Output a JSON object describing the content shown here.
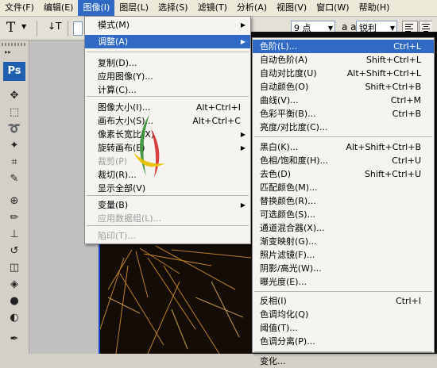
{
  "menubar": {
    "items": [
      "文件(F)",
      "编辑(E)",
      "图像(I)",
      "图层(L)",
      "选择(S)",
      "滤镜(T)",
      "分析(A)",
      "视图(V)",
      "窗口(W)",
      "帮助(H)"
    ],
    "active_index": 2
  },
  "options_bar": {
    "tool_glyph": "T",
    "font_size": "9 点",
    "antialias_icon": "a a",
    "antialias": "锐利"
  },
  "toolbox": {
    "logo": "Ps"
  },
  "image_menu": {
    "items": [
      {
        "label": "模式(M)",
        "shortcut": "",
        "submenu": true,
        "disabled": false,
        "highlighted": false
      },
      {
        "label": "调整(A)",
        "shortcut": "",
        "submenu": true,
        "disabled": false,
        "highlighted": true
      },
      {
        "label": "复制(D)...",
        "shortcut": "",
        "submenu": false,
        "disabled": false,
        "highlighted": false
      },
      {
        "label": "应用图像(Y)...",
        "shortcut": "",
        "submenu": false,
        "disabled": false,
        "highlighted": false
      },
      {
        "label": "计算(C)...",
        "shortcut": "",
        "submenu": false,
        "disabled": false,
        "highlighted": false
      },
      {
        "label": "图像大小(I)...",
        "shortcut": "Alt+Ctrl+I",
        "submenu": false,
        "disabled": false,
        "highlighted": false
      },
      {
        "label": "画布大小(S)...",
        "shortcut": "Alt+Ctrl+C",
        "submenu": false,
        "disabled": false,
        "highlighted": false
      },
      {
        "label": "像素长宽比(X)",
        "shortcut": "",
        "submenu": true,
        "disabled": false,
        "highlighted": false
      },
      {
        "label": "旋转画布(E)",
        "shortcut": "",
        "submenu": true,
        "disabled": false,
        "highlighted": false
      },
      {
        "label": "裁剪(P)",
        "shortcut": "",
        "submenu": false,
        "disabled": true,
        "highlighted": false
      },
      {
        "label": "裁切(R)...",
        "shortcut": "",
        "submenu": false,
        "disabled": false,
        "highlighted": false
      },
      {
        "label": "显示全部(V)",
        "shortcut": "",
        "submenu": false,
        "disabled": false,
        "highlighted": false
      },
      {
        "label": "变量(B)",
        "shortcut": "",
        "submenu": true,
        "disabled": false,
        "highlighted": false
      },
      {
        "label": "应用数据组(L)...",
        "shortcut": "",
        "submenu": false,
        "disabled": true,
        "highlighted": false
      },
      {
        "label": "陷印(T)...",
        "shortcut": "",
        "submenu": false,
        "disabled": true,
        "highlighted": false
      }
    ]
  },
  "adjust_menu": {
    "items": [
      {
        "label": "色阶(L)...",
        "shortcut": "Ctrl+L",
        "highlighted": true
      },
      {
        "label": "自动色阶(A)",
        "shortcut": "Shift+Ctrl+L",
        "highlighted": false
      },
      {
        "label": "自动对比度(U)",
        "shortcut": "Alt+Shift+Ctrl+L",
        "highlighted": false
      },
      {
        "label": "自动颜色(O)",
        "shortcut": "Shift+Ctrl+B",
        "highlighted": false
      },
      {
        "label": "曲线(V)...",
        "shortcut": "Ctrl+M",
        "highlighted": false
      },
      {
        "label": "色彩平衡(B)...",
        "shortcut": "Ctrl+B",
        "highlighted": false
      },
      {
        "label": "亮度/对比度(C)...",
        "shortcut": "",
        "highlighted": false
      },
      {
        "label": "黑白(K)...",
        "shortcut": "Alt+Shift+Ctrl+B",
        "highlighted": false
      },
      {
        "label": "色相/饱和度(H)...",
        "shortcut": "Ctrl+U",
        "highlighted": false
      },
      {
        "label": "去色(D)",
        "shortcut": "Shift+Ctrl+U",
        "highlighted": false
      },
      {
        "label": "匹配颜色(M)...",
        "shortcut": "",
        "highlighted": false
      },
      {
        "label": "替换颜色(R)...",
        "shortcut": "",
        "highlighted": false
      },
      {
        "label": "可选颜色(S)...",
        "shortcut": "",
        "highlighted": false
      },
      {
        "label": "通道混合器(X)...",
        "shortcut": "",
        "highlighted": false
      },
      {
        "label": "渐变映射(G)...",
        "shortcut": "",
        "highlighted": false
      },
      {
        "label": "照片滤镜(F)...",
        "shortcut": "",
        "highlighted": false
      },
      {
        "label": "阴影/高光(W)...",
        "shortcut": "",
        "highlighted": false
      },
      {
        "label": "曝光度(E)...",
        "shortcut": "",
        "highlighted": false
      },
      {
        "label": "反相(I)",
        "shortcut": "Ctrl+I",
        "highlighted": false
      },
      {
        "label": "色调均化(Q)",
        "shortcut": "",
        "highlighted": false
      },
      {
        "label": "阈值(T)...",
        "shortcut": "",
        "highlighted": false
      },
      {
        "label": "色调分离(P)...",
        "shortcut": "",
        "highlighted": false
      },
      {
        "label": "变化...",
        "shortcut": "",
        "highlighted": false
      }
    ]
  },
  "colors": {
    "highlight": "#316ac5",
    "menu_bg": "#f5f4f0",
    "disabled": "#9c9c9c",
    "logo_bg": "#1e5fb0"
  }
}
